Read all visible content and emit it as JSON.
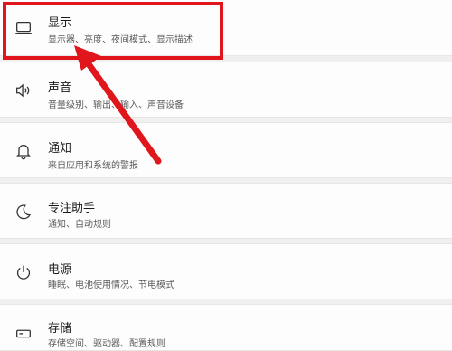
{
  "items": [
    {
      "icon": "monitor-icon",
      "title": "显示",
      "subtitle": "显示器、亮度、夜间模式、显示描述"
    },
    {
      "icon": "speaker-icon",
      "title": "声音",
      "subtitle": "音量级别、输出、输入、声音设备"
    },
    {
      "icon": "bell-icon",
      "title": "通知",
      "subtitle": "来自应用和系统的警报"
    },
    {
      "icon": "moon-icon",
      "title": "专注助手",
      "subtitle": "通知、自动规则"
    },
    {
      "icon": "power-icon",
      "title": "电源",
      "subtitle": "睡眠、电池使用情况、节电模式"
    },
    {
      "icon": "storage-icon",
      "title": "存储",
      "subtitle": "存储空间、驱动器、配置规则"
    }
  ],
  "colors": {
    "highlight": "#e0161c",
    "background": "#f0f0f0",
    "card": "#fdfdfd"
  }
}
